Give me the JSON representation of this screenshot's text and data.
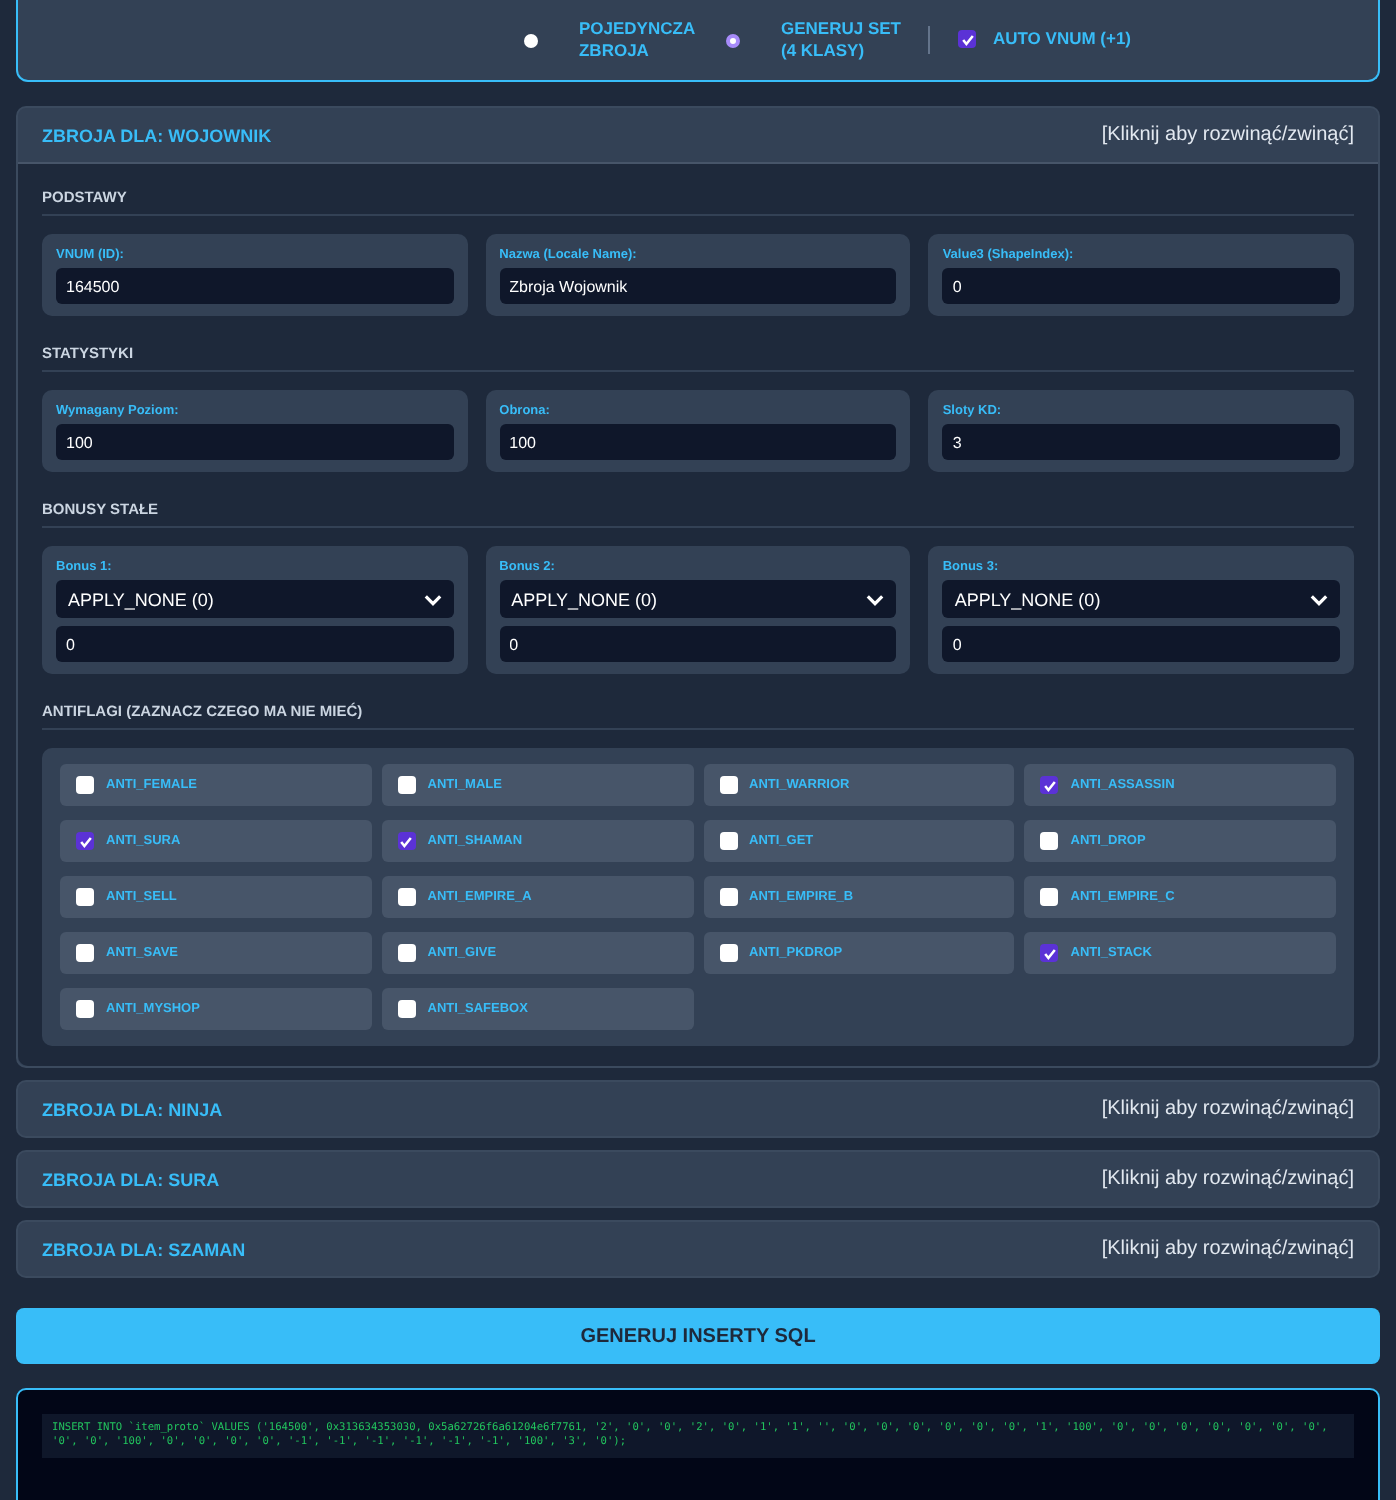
{
  "mode_bar": {
    "modes": [
      {
        "label": "POJEDYNCZA ZBROJA",
        "selected": false
      },
      {
        "label": "GENERUJ SET (4 KLASY)",
        "selected": true
      }
    ],
    "auto_vnum": {
      "label": "AUTO VNUM (+1)",
      "checked": true
    }
  },
  "sections": [
    {
      "title": "ZBROJA DLA: WOJOWNIK",
      "hint": "[Kliknij aby rozwinąć/zwinąć]",
      "expanded": true,
      "groups": [
        {
          "title": "PODSTAWY",
          "kind": "fields",
          "fields": [
            {
              "label": "VNUM (ID):",
              "value": "164500"
            },
            {
              "label": "Nazwa (Locale Name):",
              "value": "Zbroja Wojownik"
            },
            {
              "label": "Value3 (ShapeIndex):",
              "value": "0"
            }
          ]
        },
        {
          "title": "STATYSTYKI",
          "kind": "fields",
          "fields": [
            {
              "label": "Wymagany Poziom:",
              "value": "100"
            },
            {
              "label": "Obrona:",
              "value": "100"
            },
            {
              "label": "Sloty KD:",
              "value": "3"
            }
          ]
        },
        {
          "title": "BONUSY STAŁE",
          "kind": "bonuses",
          "fields": [
            {
              "label": "Bonus 1:",
              "option": "APPLY_NONE (0)",
              "value": "0"
            },
            {
              "label": "Bonus 2:",
              "option": "APPLY_NONE (0)",
              "value": "0"
            },
            {
              "label": "Bonus 3:",
              "option": "APPLY_NONE (0)",
              "value": "0"
            }
          ]
        },
        {
          "title": "ANTIFLAGI (ZAZNACZ CZEGO MA NIE MIEĆ)",
          "kind": "flags",
          "flags": [
            {
              "label": "ANTI_FEMALE",
              "checked": false
            },
            {
              "label": "ANTI_MALE",
              "checked": false
            },
            {
              "label": "ANTI_WARRIOR",
              "checked": false
            },
            {
              "label": "ANTI_ASSASSIN",
              "checked": true
            },
            {
              "label": "ANTI_SURA",
              "checked": true
            },
            {
              "label": "ANTI_SHAMAN",
              "checked": true
            },
            {
              "label": "ANTI_GET",
              "checked": false
            },
            {
              "label": "ANTI_DROP",
              "checked": false
            },
            {
              "label": "ANTI_SELL",
              "checked": false
            },
            {
              "label": "ANTI_EMPIRE_A",
              "checked": false
            },
            {
              "label": "ANTI_EMPIRE_B",
              "checked": false
            },
            {
              "label": "ANTI_EMPIRE_C",
              "checked": false
            },
            {
              "label": "ANTI_SAVE",
              "checked": false
            },
            {
              "label": "ANTI_GIVE",
              "checked": false
            },
            {
              "label": "ANTI_PKDROP",
              "checked": false
            },
            {
              "label": "ANTI_STACK",
              "checked": true
            },
            {
              "label": "ANTI_MYSHOP",
              "checked": false
            },
            {
              "label": "ANTI_SAFEBOX",
              "checked": false
            }
          ]
        }
      ]
    },
    {
      "title": "ZBROJA DLA: NINJA",
      "hint": "[Kliknij aby rozwinąć/zwinąć]",
      "expanded": false
    },
    {
      "title": "ZBROJA DLA: SURA",
      "hint": "[Kliknij aby rozwinąć/zwinąć]",
      "expanded": false
    },
    {
      "title": "ZBROJA DLA: SZAMAN",
      "hint": "[Kliknij aby rozwinąć/zwinąć]",
      "expanded": false
    }
  ],
  "generate_button": "GENERUJ INSERTY SQL",
  "sql_output": "INSERT INTO `item_proto` VALUES ('164500', 0x313634353030, 0x5a62726f6a61204e6f7761, '2', '0', '0', '2', '0', '1', '1', '', '0', '0', '0', '0', '0', '0', '1', '100', '0', '0', '0', '0', '0', '0', '0', '0', '0', '100', '0', '0', '0', '0', '-1', '-1', '-1', '-1', '-1', '-1', '100', '3', '0');"
}
